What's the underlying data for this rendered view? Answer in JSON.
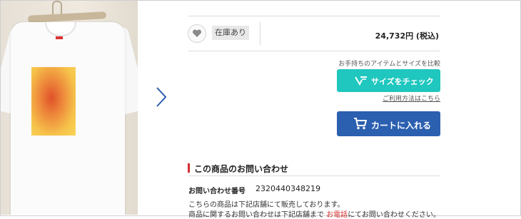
{
  "product": {
    "stock_label": "在庫あり",
    "price": "24,732円 (税込)"
  },
  "size_check": {
    "compare_text": "お手持ちのアイテムとサイズを比較",
    "button_label": "サイズをチェック",
    "howto_link": "ご利用方法はこちら"
  },
  "cart": {
    "button_label": "カートに入れる"
  },
  "inquiry": {
    "title": "この商品のお問い合わせ",
    "number_label": "お問い合わせ番号",
    "number_value": "2320440348219",
    "line1": "こちらの商品は下記店舗にて販売しております。",
    "line2_before": "商品に関するお問い合わせは下記店舗まで ",
    "line2_link": "お電話",
    "line2_after": "にてお問い合わせください。"
  },
  "colors": {
    "size_button": "#1fc7be",
    "cart_button": "#2b5fb0",
    "accent_red": "#d32f2f"
  },
  "icons": [
    "heart-icon",
    "chevron-right-icon",
    "size-check-logo-icon",
    "cart-icon"
  ]
}
